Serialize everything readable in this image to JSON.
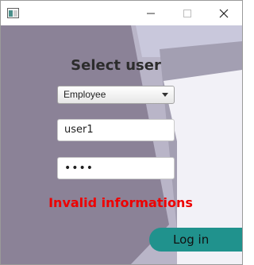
{
  "window": {
    "title": ""
  },
  "form": {
    "heading": "Select user",
    "role_selected": "Employee",
    "username_value": "user1",
    "password_mask": "••••",
    "error_message": "Invalid informations",
    "login_label": "Log in"
  },
  "colors": {
    "background": "#8b8297",
    "accent_button": "#20928d",
    "error": "#ee0000"
  },
  "icons": {
    "app": "window-app-icon",
    "minimize": "minimize-icon",
    "maximize": "maximize-icon",
    "close": "close-icon",
    "dropdown": "chevron-down-icon"
  }
}
